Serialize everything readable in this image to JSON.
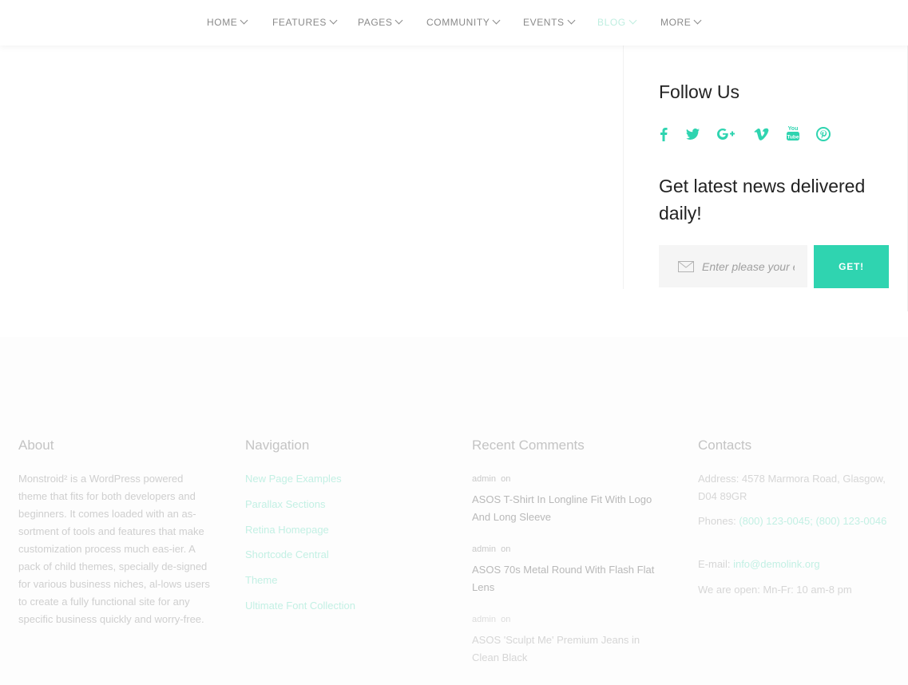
{
  "nav": [
    {
      "label": "HOME"
    },
    {
      "label": "FEATURES"
    },
    {
      "label": "PAGES"
    },
    {
      "label": "COMMUNITY"
    },
    {
      "label": "EVENTS"
    },
    {
      "label": "BLOG",
      "active": true
    },
    {
      "label": "MORE"
    }
  ],
  "sidebar": {
    "follow_title": "Follow Us",
    "social_icons": [
      "facebook-icon",
      "twitter-icon",
      "google-plus-icon",
      "vimeo-icon",
      "youtube-icon",
      "pinterest-icon"
    ],
    "news_title_line1": "Get latest news delivered",
    "news_title_line2": "daily!",
    "email_placeholder": "Enter please your e-mail",
    "get_button": "GET!"
  },
  "footer": {
    "about_title": "About",
    "about_text": "Monstroid² is a WordPress powered theme that fits for both developers and beginners. It comes loaded with an as-sortment of tools and features that make customization process much eas-ier. A pack of child themes, specially de-signed for various business niches, al-lows users to create a fully functional site for any specific business quickly and worry-free.",
    "nav_title": "Navigation",
    "nav_links": [
      "New Page Examples",
      "Parallax Sections",
      "Retina Homepage",
      "Shortcode Central",
      "Theme",
      "Ultimate Font Collection"
    ],
    "comments_title": "Recent Comments",
    "comments": [
      {
        "author": "admin",
        "on": "on",
        "title": "ASOS T-Shirt In Longline Fit With Logo And Long Sleeve"
      },
      {
        "author": "admin",
        "on": "on",
        "title": "ASOS 70s Metal Round With Flash Flat Lens"
      },
      {
        "author": "admin",
        "on": "on",
        "title": "ASOS 'Sculpt Me' Premium Jeans in Clean Black"
      }
    ],
    "contacts_title": "Contacts",
    "address": "Address: 4578 Marmora Road, Glasgow, D04 89GR",
    "phones_label": "Phones:",
    "phones": "(800) 123-0045; (800) 123-0046",
    "email_label": "E-mail:",
    "email": "info@demolink.org",
    "hours": "We are open: Mn-Fr: 10 am-8 pm"
  },
  "colors": {
    "accent": "#2fd4b0"
  }
}
